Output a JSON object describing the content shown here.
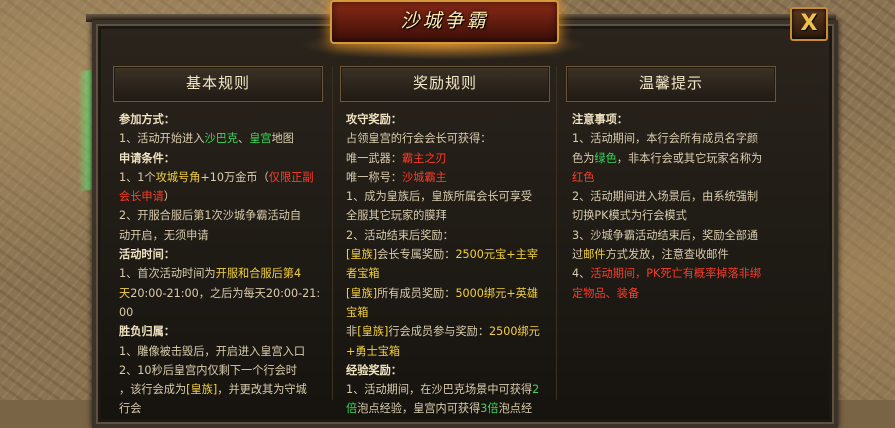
{
  "window": {
    "title": "沙城争霸",
    "close_label": "X"
  },
  "columns": [
    {
      "heading": "基本规则",
      "lines": [
        [
          {
            "t": "参加方式：",
            "c": "h"
          }
        ],
        [
          {
            "t": "1、活动开始进入"
          },
          {
            "t": "沙巴克",
            "c": "g"
          },
          {
            "t": "、"
          },
          {
            "t": "皇宫",
            "c": "g"
          },
          {
            "t": "地图"
          }
        ],
        [
          {
            "t": "申请条件：",
            "c": "h"
          }
        ],
        [
          {
            "t": "1、1个"
          },
          {
            "t": "攻城号角",
            "c": "y"
          },
          {
            "t": "+10万金币（"
          },
          {
            "t": "仅限正副",
            "c": "r"
          }
        ],
        [
          {
            "t": "会长申请",
            "c": "r"
          },
          {
            "t": "）"
          }
        ],
        [
          {
            "t": "2、开服合服后第1次沙城争霸活动自"
          }
        ],
        [
          {
            "t": "动开启，无须申请"
          }
        ],
        [
          {
            "t": "活动时间：",
            "c": "h"
          }
        ],
        [
          {
            "t": "1、首次活动时间为"
          },
          {
            "t": "开服和合服后第4",
            "c": "y"
          }
        ],
        [
          {
            "t": "天",
            "c": "y"
          },
          {
            "t": "20:00-21:00，之后为每天20:00-21:"
          }
        ],
        [
          {
            "t": "00"
          }
        ],
        [
          {
            "t": "胜负归属：",
            "c": "h"
          }
        ],
        [
          {
            "t": "1、雕像被击毁后，开启进入皇宫入口"
          }
        ],
        [
          {
            "t": "2、10秒后皇宫内仅剩下一个行会时"
          }
        ],
        [
          {
            "t": "，该行会成为"
          },
          {
            "t": "[皇族]",
            "c": "y"
          },
          {
            "t": "，并更改其为守城"
          }
        ],
        [
          {
            "t": "行会"
          }
        ]
      ]
    },
    {
      "heading": "奖励规则",
      "lines": [
        [
          {
            "t": "攻守奖励：",
            "c": "h"
          }
        ],
        [
          {
            "t": "占领皇宫的行会会长可获得："
          }
        ],
        [
          {
            "t": "唯一武器："
          },
          {
            "t": "霸主之刃",
            "c": "r"
          }
        ],
        [
          {
            "t": "唯一称号："
          },
          {
            "t": "沙城霸主",
            "c": "r"
          }
        ],
        [
          {
            "t": "1、成为皇族后，皇族所属会长可享受"
          }
        ],
        [
          {
            "t": "全服其它玩家的膜拜"
          }
        ],
        [
          {
            "t": "2、活动结束后奖励："
          }
        ],
        [
          {
            "t": "[皇族]",
            "c": "y"
          },
          {
            "t": "会长专属奖励："
          },
          {
            "t": "2500元宝+主宰",
            "c": "y"
          }
        ],
        [
          {
            "t": "者宝箱",
            "c": "y"
          }
        ],
        [
          {
            "t": "[皇族]",
            "c": "y"
          },
          {
            "t": "所有成员奖励："
          },
          {
            "t": "5000绑元+英雄",
            "c": "y"
          }
        ],
        [
          {
            "t": "宝箱",
            "c": "y"
          }
        ],
        [
          {
            "t": "非"
          },
          {
            "t": "[皇族]",
            "c": "y"
          },
          {
            "t": "行会成员参与奖励："
          },
          {
            "t": "2500绑元",
            "c": "y"
          }
        ],
        [
          {
            "t": "+勇士宝箱",
            "c": "y"
          }
        ],
        [
          {
            "t": "经验奖励：",
            "c": "h"
          }
        ],
        [
          {
            "t": "1、活动期间，在沙巴克场景中可获得"
          },
          {
            "t": "2",
            "c": "g"
          }
        ],
        [
          {
            "t": "倍",
            "c": "g"
          },
          {
            "t": "泡点经验，皇宫内可获得"
          },
          {
            "t": "3倍",
            "c": "g"
          },
          {
            "t": "泡点经"
          }
        ]
      ]
    },
    {
      "heading": "温馨提示",
      "lines": [
        [
          {
            "t": "注意事项：",
            "c": "h"
          }
        ],
        [
          {
            "t": "1、活动期间，本行会所有成员名字颜"
          }
        ],
        [
          {
            "t": "色为"
          },
          {
            "t": "绿色",
            "c": "g"
          },
          {
            "t": "，非本行会或其它玩家名称为"
          }
        ],
        [
          {
            "t": "红色",
            "c": "r"
          }
        ],
        [
          {
            "t": "2、活动期间进入场景后，由系统强制"
          }
        ],
        [
          {
            "t": "切换PK模式为行会模式"
          }
        ],
        [
          {
            "t": "3、沙城争霸活动结束后，奖励全部通"
          }
        ],
        [
          {
            "t": "过"
          },
          {
            "t": "邮件",
            "c": "y"
          },
          {
            "t": "方式发放，注意查收邮件"
          }
        ],
        [
          {
            "t": "4、"
          },
          {
            "t": "活动期间，PK死亡有概率掉落非绑",
            "c": "r"
          }
        ],
        [
          {
            "t": "定物品、装备",
            "c": "r"
          }
        ]
      ]
    }
  ]
}
